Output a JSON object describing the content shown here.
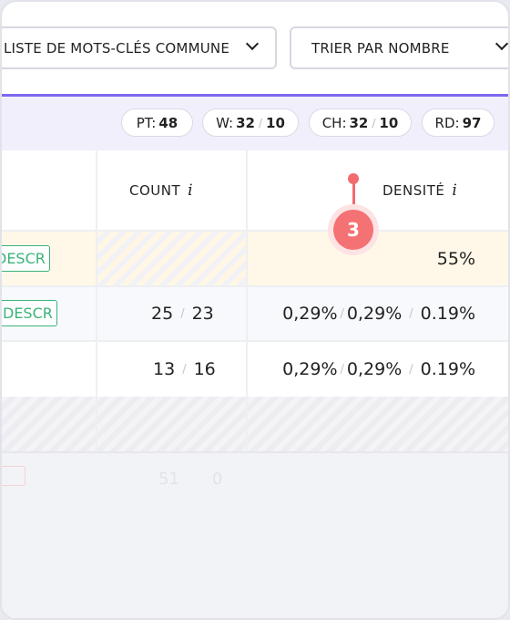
{
  "filters": {
    "keyword_list": "LISTE DE MOTS-CLÉS COMMUNE",
    "sort": "TRIER PAR NOMBRE"
  },
  "colors": {
    "accent": "#7c68ee",
    "band": "#f1effc",
    "tag": "#3cb37a",
    "marker": "#f47274",
    "highlight_row": "#fff8e8"
  },
  "stats": [
    {
      "label": "PT:",
      "value": "48"
    },
    {
      "label": "W:",
      "value": "32",
      "value2": "10"
    },
    {
      "label": "CH:",
      "value": "32",
      "value2": "10"
    },
    {
      "label": "RD:",
      "value": "97"
    }
  ],
  "table": {
    "headers": {
      "count": "COUNT",
      "density": "DENSITÉ",
      "info": "i"
    },
    "rows": [
      {
        "tag": "DESCR",
        "count": null,
        "density": "55%"
      },
      {
        "tag": "DESCR",
        "count": [
          "25",
          "23"
        ],
        "density": [
          "0,29%",
          "0,29%",
          "0.19%"
        ]
      },
      {
        "tag": null,
        "count": [
          "13",
          "16"
        ],
        "density": [
          "0,29%",
          "0,29%",
          "0.19%"
        ]
      }
    ],
    "faded_count": [
      "51",
      "0"
    ]
  },
  "marker": {
    "number": "3"
  },
  "sep": "/"
}
